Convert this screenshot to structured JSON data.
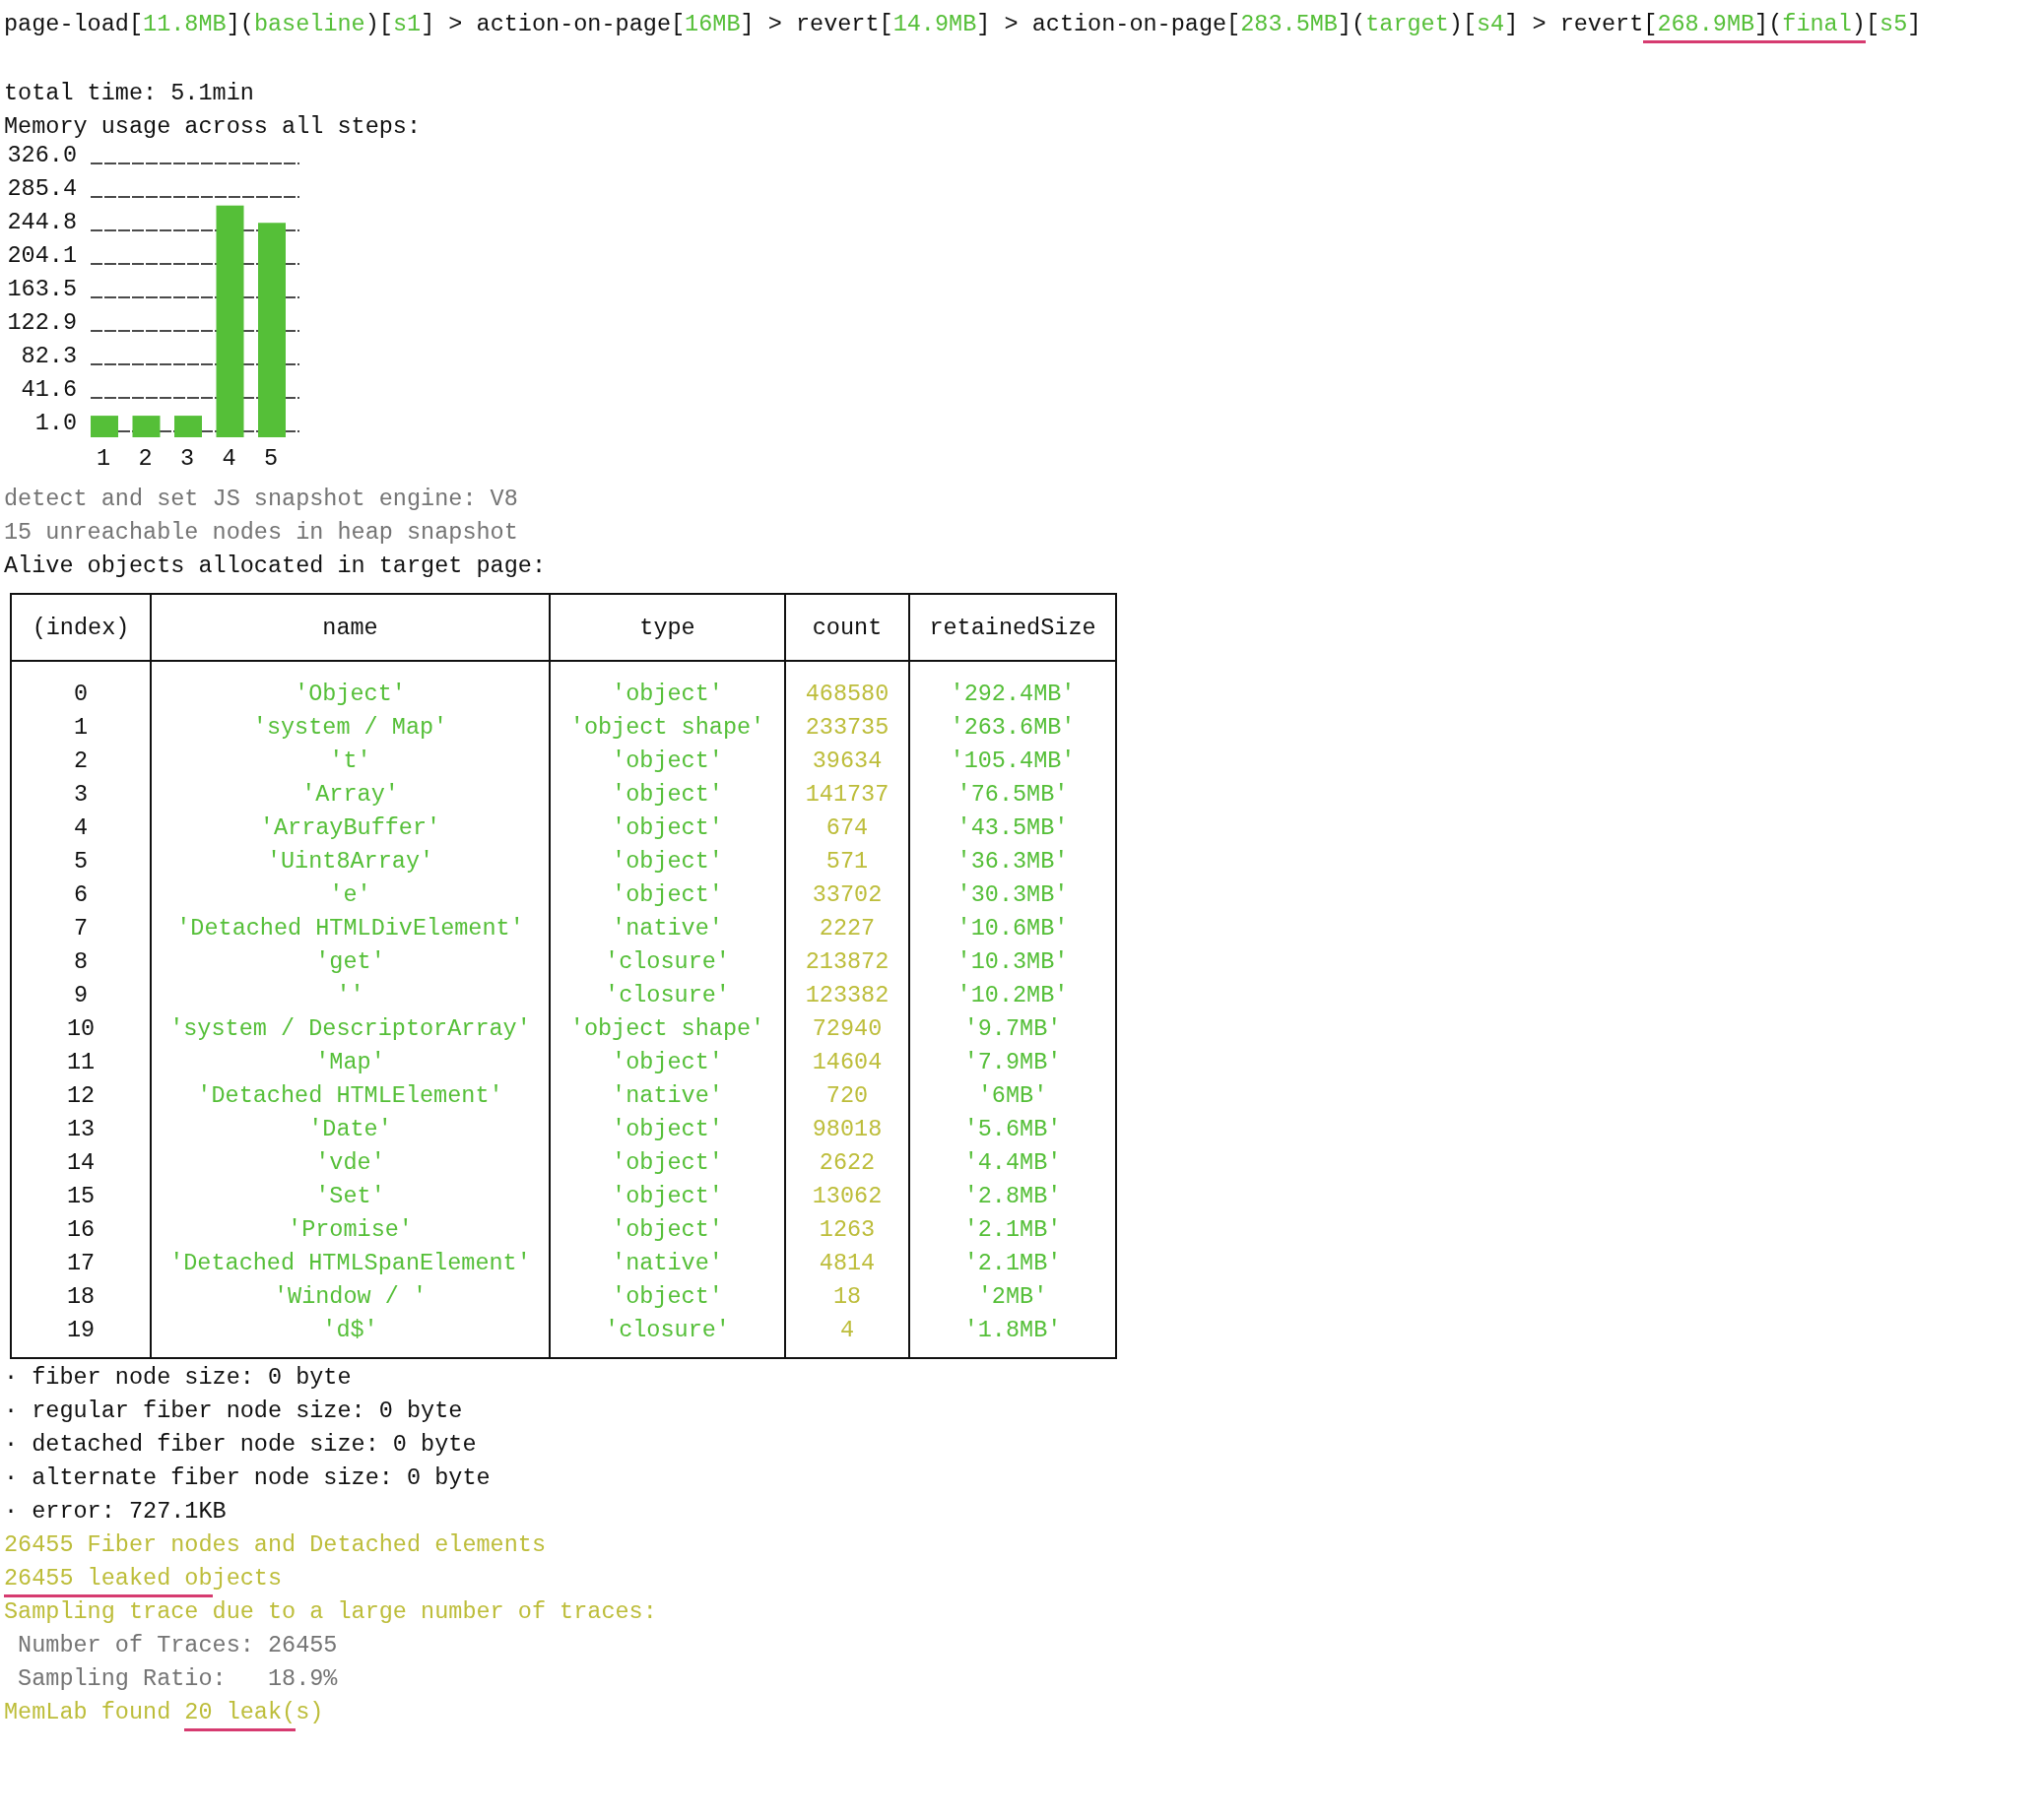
{
  "top_line": {
    "segments": [
      {
        "text": "page-load[",
        "kind": "plain",
        "marked": false
      },
      {
        "text": "11.8MB",
        "kind": "value",
        "marked": false
      },
      {
        "text": "](",
        "kind": "plain",
        "marked": false
      },
      {
        "text": "baseline",
        "kind": "value",
        "marked": false
      },
      {
        "text": ")[",
        "kind": "plain",
        "marked": false
      },
      {
        "text": "s1",
        "kind": "value",
        "marked": false
      },
      {
        "text": "] > action-on-page[",
        "kind": "plain",
        "marked": false
      },
      {
        "text": "16MB",
        "kind": "value",
        "marked": false
      },
      {
        "text": "] > revert[",
        "kind": "plain",
        "marked": false
      },
      {
        "text": "14.9MB",
        "kind": "value",
        "marked": false
      },
      {
        "text": "] > action-on-page[",
        "kind": "plain",
        "marked": false
      },
      {
        "text": "283.5MB",
        "kind": "value",
        "marked": false
      },
      {
        "text": "](",
        "kind": "plain",
        "marked": false
      },
      {
        "text": "target",
        "kind": "value",
        "marked": false
      },
      {
        "text": ")[",
        "kind": "plain",
        "marked": false
      },
      {
        "text": "s4",
        "kind": "value",
        "marked": false
      },
      {
        "text": "] > revert",
        "kind": "plain",
        "marked": false
      },
      {
        "text": "[",
        "kind": "plain",
        "marked": true
      },
      {
        "text": "268.9MB",
        "kind": "value",
        "marked": true
      },
      {
        "text": "](",
        "kind": "plain",
        "marked": true
      },
      {
        "text": "final",
        "kind": "value",
        "marked": true
      },
      {
        "text": ")",
        "kind": "plain",
        "marked": true
      },
      {
        "text": "[",
        "kind": "plain",
        "marked": false
      },
      {
        "text": "s5",
        "kind": "value",
        "marked": false
      },
      {
        "text": "]",
        "kind": "plain",
        "marked": false
      }
    ]
  },
  "total_time": "total time: 5.1min",
  "chart_heading": "Memory usage across all steps:",
  "memory_chart": {
    "chart_data": {
      "type": "bar",
      "categories": [
        "1",
        "2",
        "3",
        "4",
        "5"
      ],
      "grid": true,
      "series": [
        {
          "color": "#55bf38",
          "values": [
            20,
            20,
            20,
            275,
            254
          ]
        }
      ],
      "ylim": [
        1.0,
        326.0
      ],
      "yticks": [
        {
          "value": 1.0,
          "label": "1.0"
        },
        {
          "value": 41.6,
          "label": "41.6"
        },
        {
          "value": 82.3,
          "label": "82.3"
        },
        {
          "value": 122.9,
          "label": "122.9"
        },
        {
          "value": 163.5,
          "label": "163.5"
        },
        {
          "value": 204.1,
          "label": "204.1"
        },
        {
          "value": 244.8,
          "label": "244.8"
        },
        {
          "value": 285.4,
          "label": "285.4"
        },
        {
          "value": 326.0,
          "label": "326.0"
        }
      ]
    }
  },
  "log_lines": [
    {
      "text": "detect and set JS snapshot engine: V8",
      "kind": "muted"
    },
    {
      "text": "15 unreachable nodes in heap snapshot",
      "kind": "muted"
    },
    {
      "text": "Alive objects allocated in target page:",
      "kind": "plain"
    }
  ],
  "table": {
    "columns": [
      "(index)",
      "name",
      "type",
      "count",
      "retainedSize"
    ],
    "rows": [
      [
        "0",
        "'Object'",
        "'object'",
        "468580",
        "'292.4MB'"
      ],
      [
        "1",
        "'system / Map'",
        "'object shape'",
        "233735",
        "'263.6MB'"
      ],
      [
        "2",
        "'t'",
        "'object'",
        "39634",
        "'105.4MB'"
      ],
      [
        "3",
        "'Array'",
        "'object'",
        "141737",
        "'76.5MB'"
      ],
      [
        "4",
        "'ArrayBuffer'",
        "'object'",
        "674",
        "'43.5MB'"
      ],
      [
        "5",
        "'Uint8Array'",
        "'object'",
        "571",
        "'36.3MB'"
      ],
      [
        "6",
        "'e'",
        "'object'",
        "33702",
        "'30.3MB'"
      ],
      [
        "7",
        "'Detached HTMLDivElement'",
        "'native'",
        "2227",
        "'10.6MB'"
      ],
      [
        "8",
        "'get'",
        "'closure'",
        "213872",
        "'10.3MB'"
      ],
      [
        "9",
        "''",
        "'closure'",
        "123382",
        "'10.2MB'"
      ],
      [
        "10",
        "'system / DescriptorArray'",
        "'object shape'",
        "72940",
        "'9.7MB'"
      ],
      [
        "11",
        "'Map'",
        "'object'",
        "14604",
        "'7.9MB'"
      ],
      [
        "12",
        "'Detached HTMLElement'",
        "'native'",
        "720",
        "'6MB'"
      ],
      [
        "13",
        "'Date'",
        "'object'",
        "98018",
        "'5.6MB'"
      ],
      [
        "14",
        "'vde'",
        "'object'",
        "2622",
        "'4.4MB'"
      ],
      [
        "15",
        "'Set'",
        "'object'",
        "13062",
        "'2.8MB'"
      ],
      [
        "16",
        "'Promise'",
        "'object'",
        "1263",
        "'2.1MB'"
      ],
      [
        "17",
        "'Detached HTMLSpanElement'",
        "'native'",
        "4814",
        "'2.1MB'"
      ],
      [
        "18",
        "'Window / '",
        "'object'",
        "18",
        "'2MB'"
      ],
      [
        "19",
        "'d$'",
        "'closure'",
        "4",
        "'1.8MB'"
      ]
    ]
  },
  "summary_lines": [
    {
      "kind": "bullet",
      "segments": [
        {
          "text": "· fiber node size: 0 byte",
          "marked": false
        }
      ]
    },
    {
      "kind": "bullet",
      "segments": [
        {
          "text": "· regular fiber node size: 0 byte",
          "marked": false
        }
      ]
    },
    {
      "kind": "bullet",
      "segments": [
        {
          "text": "· detached fiber node size: 0 byte",
          "marked": false
        }
      ]
    },
    {
      "kind": "bullet",
      "segments": [
        {
          "text": "· alternate fiber node size: 0 byte",
          "marked": false
        }
      ]
    },
    {
      "kind": "bullet",
      "segments": [
        {
          "text": "· error: 727.1KB",
          "marked": false
        }
      ]
    },
    {
      "kind": "warning",
      "segments": [
        {
          "text": "26455 Fiber nodes and Detached elements",
          "marked": false
        }
      ]
    },
    {
      "kind": "warning",
      "segments": [
        {
          "text": "26455 leaked ob",
          "marked": true
        },
        {
          "text": "jects",
          "marked": false
        }
      ]
    },
    {
      "kind": "warning",
      "segments": [
        {
          "text": "Sampling trace due to a large number of traces:",
          "marked": false
        }
      ]
    },
    {
      "kind": "muted",
      "segments": [
        {
          "text": " Number of Traces: 26455",
          "marked": false
        }
      ]
    },
    {
      "kind": "muted",
      "segments": [
        {
          "text": " Sampling Ratio:   18.9%",
          "marked": false
        }
      ]
    },
    {
      "kind": "warning",
      "segments": [
        {
          "text": "MemLab found ",
          "marked": false
        },
        {
          "text": "20 leak(",
          "marked": true
        },
        {
          "text": "s)",
          "marked": false
        }
      ]
    }
  ]
}
